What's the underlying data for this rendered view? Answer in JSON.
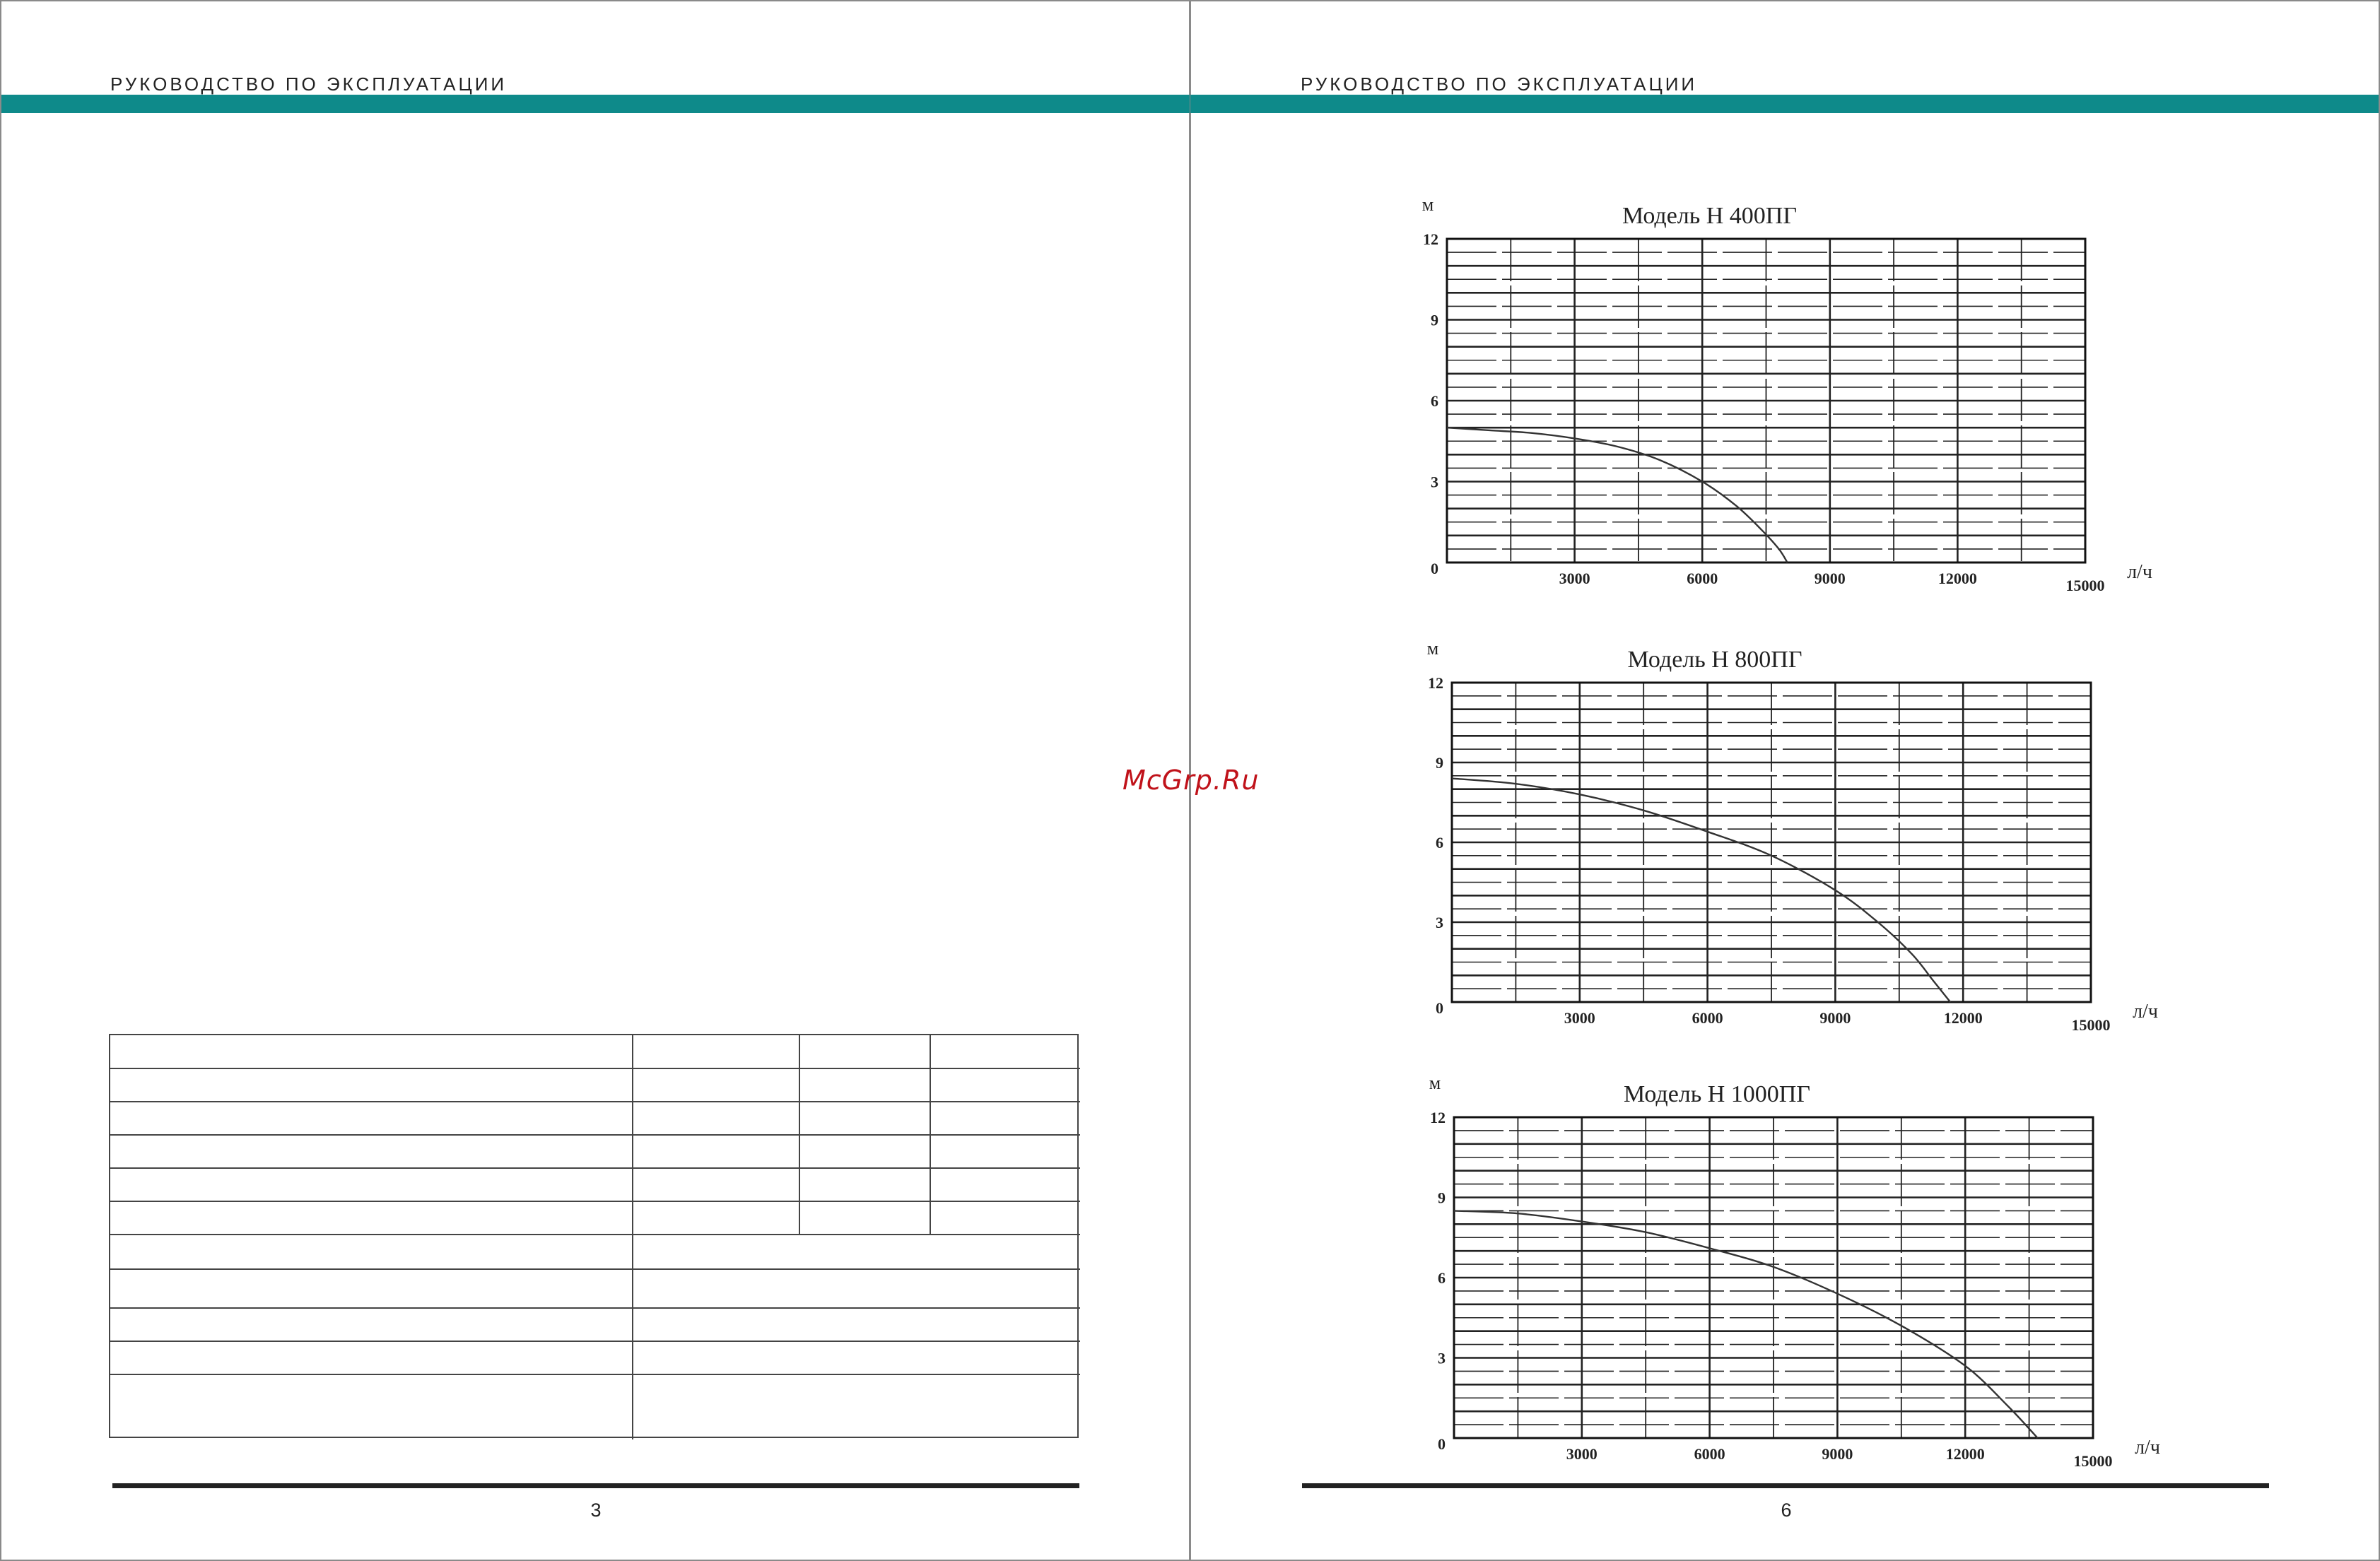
{
  "header": {
    "left_title": "РУКОВОДСТВО ПО ЭКСПЛУАТАЦИИ",
    "right_title": "РУКОВОДСТВО ПО ЭКСПЛУАТАЦИИ"
  },
  "footer": {
    "left_page": "3",
    "right_page": "6"
  },
  "watermark": "McGrp.Ru",
  "colors": {
    "band": "#0e8a8a",
    "watermark": "#c0121a"
  },
  "chart_data": [
    {
      "type": "line",
      "title": "Модель Н 400ПГ",
      "ylabel": "м",
      "xlabel": "л/ч",
      "xlim": [
        0,
        15000
      ],
      "ylim": [
        0,
        12
      ],
      "x_ticks": [
        "3000",
        "6000",
        "9000",
        "12000",
        "15000"
      ],
      "y_ticks": [
        "0",
        "3",
        "6",
        "9",
        "12"
      ],
      "grid": true,
      "series": [
        {
          "x": [
            0,
            1000,
            2000,
            3000,
            4000,
            5000,
            6000,
            6800,
            7400,
            7800,
            8000
          ],
          "y": [
            5.0,
            4.9,
            4.8,
            4.6,
            4.3,
            3.8,
            3.0,
            2.1,
            1.2,
            0.5,
            0
          ]
        }
      ]
    },
    {
      "type": "line",
      "title": "Модель Н 800ПГ",
      "ylabel": "м",
      "xlabel": "л/ч",
      "xlim": [
        0,
        15000
      ],
      "ylim": [
        0,
        12
      ],
      "x_ticks": [
        "3000",
        "6000",
        "9000",
        "12000",
        "15000"
      ],
      "y_ticks": [
        "0",
        "3",
        "6",
        "9",
        "12"
      ],
      "grid": true,
      "series": [
        {
          "x": [
            0,
            1500,
            3000,
            4500,
            6000,
            7500,
            9000,
            10000,
            10800,
            11300,
            11700
          ],
          "y": [
            8.4,
            8.2,
            7.8,
            7.2,
            6.4,
            5.5,
            4.2,
            3.0,
            1.8,
            0.8,
            0
          ]
        }
      ]
    },
    {
      "type": "line",
      "title": "Модель Н 1000ПГ",
      "ylabel": "м",
      "xlabel": "л/ч",
      "xlim": [
        0,
        15000
      ],
      "ylim": [
        0,
        12
      ],
      "x_ticks": [
        "3000",
        "6000",
        "9000",
        "12000",
        "15000"
      ],
      "y_ticks": [
        "0",
        "3",
        "6",
        "9",
        "12"
      ],
      "grid": true,
      "series": [
        {
          "x": [
            0,
            1500,
            3000,
            4500,
            6000,
            7500,
            9000,
            10500,
            12000,
            13000,
            13700
          ],
          "y": [
            8.5,
            8.4,
            8.1,
            7.7,
            7.1,
            6.4,
            5.4,
            4.2,
            2.7,
            1.2,
            0
          ]
        }
      ]
    }
  ]
}
